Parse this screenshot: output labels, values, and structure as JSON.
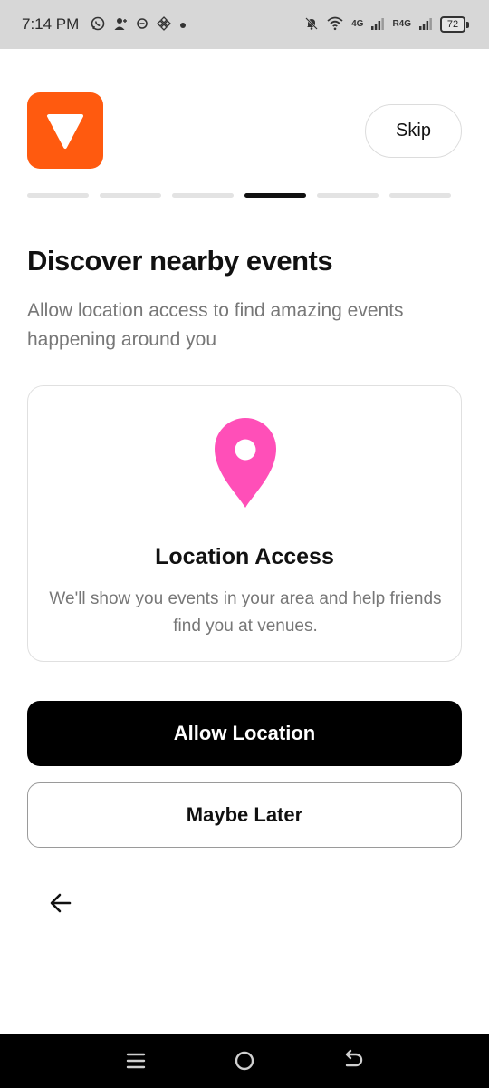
{
  "status_bar": {
    "time": "7:14 PM",
    "battery": "72",
    "net1": "4G",
    "net2": "R4G",
    "icons": [
      "whatsapp-icon",
      "person-icon",
      "sync-icon",
      "binance-icon",
      "dot-icon",
      "bell-off-icon",
      "wifi-icon",
      "signal-icon",
      "signal-icon",
      "battery-icon"
    ]
  },
  "header": {
    "logo_color": "#ff5a0f",
    "skip_label": "Skip"
  },
  "progress": {
    "total_steps": 6,
    "current_step": 4
  },
  "content": {
    "title": "Discover nearby events",
    "subtitle": "Allow location access to find amazing events happening around you"
  },
  "card": {
    "icon": "map-pin-icon",
    "icon_color": "#ff4fb8",
    "title": "Location Access",
    "description": "We'll show you events in your area and help friends find you at venues."
  },
  "actions": {
    "primary_label": "Allow Location",
    "secondary_label": "Maybe Later",
    "back_icon": "arrow-left-icon"
  },
  "nav_bar": {
    "icons": [
      "recent-apps-icon",
      "home-icon",
      "back-icon"
    ]
  }
}
